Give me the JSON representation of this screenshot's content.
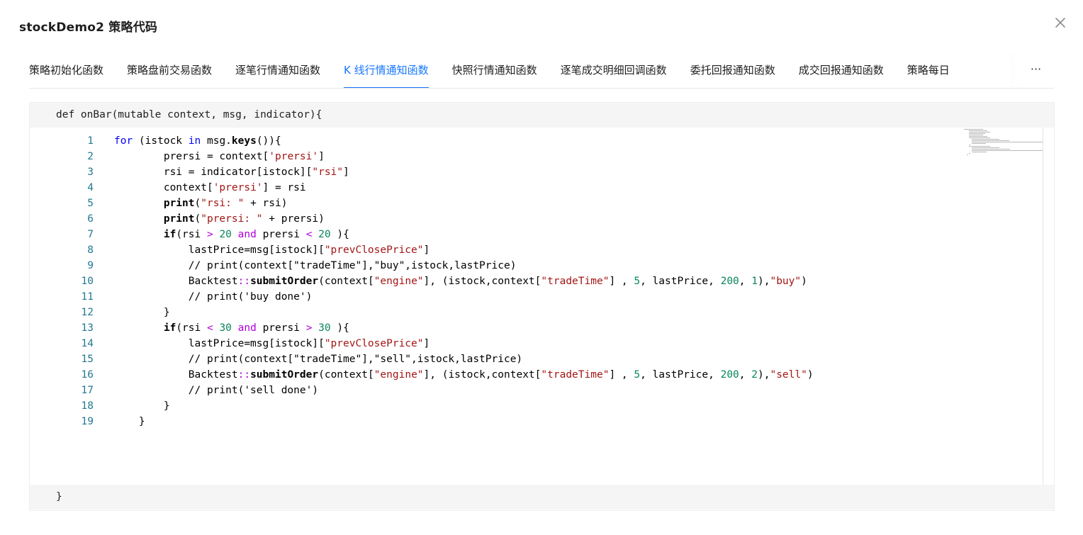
{
  "modal": {
    "title": "stockDemo2 策略代码"
  },
  "tabs": [
    {
      "label": "策略初始化函数",
      "active": false
    },
    {
      "label": "策略盘前交易函数",
      "active": false
    },
    {
      "label": "逐笔行情通知函数",
      "active": false
    },
    {
      "label": "K 线行情通知函数",
      "active": true
    },
    {
      "label": "快照行情通知函数",
      "active": false
    },
    {
      "label": "逐笔成交明细回调函数",
      "active": false
    },
    {
      "label": "委托回报通知函数",
      "active": false
    },
    {
      "label": "成交回报通知函数",
      "active": false
    },
    {
      "label": "策略每日",
      "active": false
    }
  ],
  "tabs_more_label": "···",
  "code": {
    "header": "def onBar(mutable context, msg, indicator){",
    "footer": "}",
    "line_numbers": [
      "1",
      "2",
      "3",
      "4",
      "5",
      "6",
      "7",
      "8",
      "9",
      "10",
      "11",
      "12",
      "13",
      "14",
      "15",
      "16",
      "17",
      "18",
      "19"
    ],
    "lines": [
      "for (istock in msg.keys()){",
      "        prersi = context['prersi']",
      "        rsi = indicator[istock][\"rsi\"]",
      "        context['prersi'] = rsi",
      "        print(\"rsi: \" + rsi)",
      "        print(\"prersi: \" + prersi)",
      "        if(rsi > 20 and prersi < 20 ){",
      "            lastPrice=msg[istock][\"prevClosePrice\"]",
      "            // print(context[\"tradeTime\"],\"buy\",istock,lastPrice)",
      "            Backtest::submitOrder(context[\"engine\"], (istock,context[\"tradeTime\"] , 5, lastPrice, 200, 1),\"buy\")",
      "            // print('buy done')",
      "        }",
      "        if(rsi < 30 and prersi > 30 ){",
      "            lastPrice=msg[istock][\"prevClosePrice\"]",
      "            // print(context[\"tradeTime\"],\"sell\",istock,lastPrice)",
      "            Backtest::submitOrder(context[\"engine\"], (istock,context[\"tradeTime\"] , 5, lastPrice, 200, 2),\"sell\")",
      "            // print('sell done')",
      "        }",
      "    }"
    ]
  },
  "colors": {
    "accent": "#1677ff",
    "keyword": "#0000ff",
    "control_keyword": "#af00db",
    "string": "#a31515",
    "number": "#098658",
    "line_number": "#237893"
  }
}
